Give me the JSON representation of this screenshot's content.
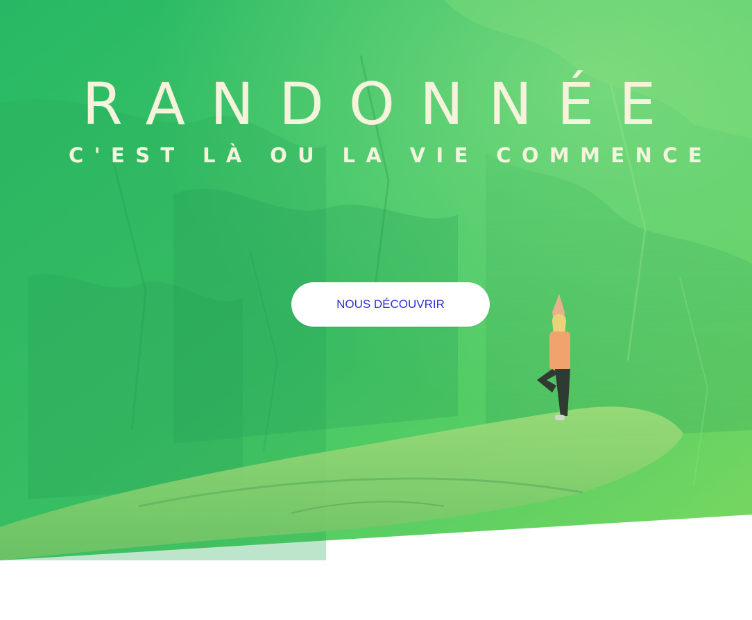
{
  "hero": {
    "title": "RANDONNÉE",
    "subtitle": "C'EST LÀ OU LA VIE COMMENCE",
    "cta_label": "NOUS DÉCOUVRIR"
  },
  "colors": {
    "overlay_top": "#2fc06b",
    "overlay_bottom": "#6bd65a",
    "title_text": "#f6f3dc",
    "button_bg": "#ffffff",
    "button_text": "#2d2fd8"
  },
  "icons": {
    "hero_image": "mountain-yoga-photo"
  }
}
